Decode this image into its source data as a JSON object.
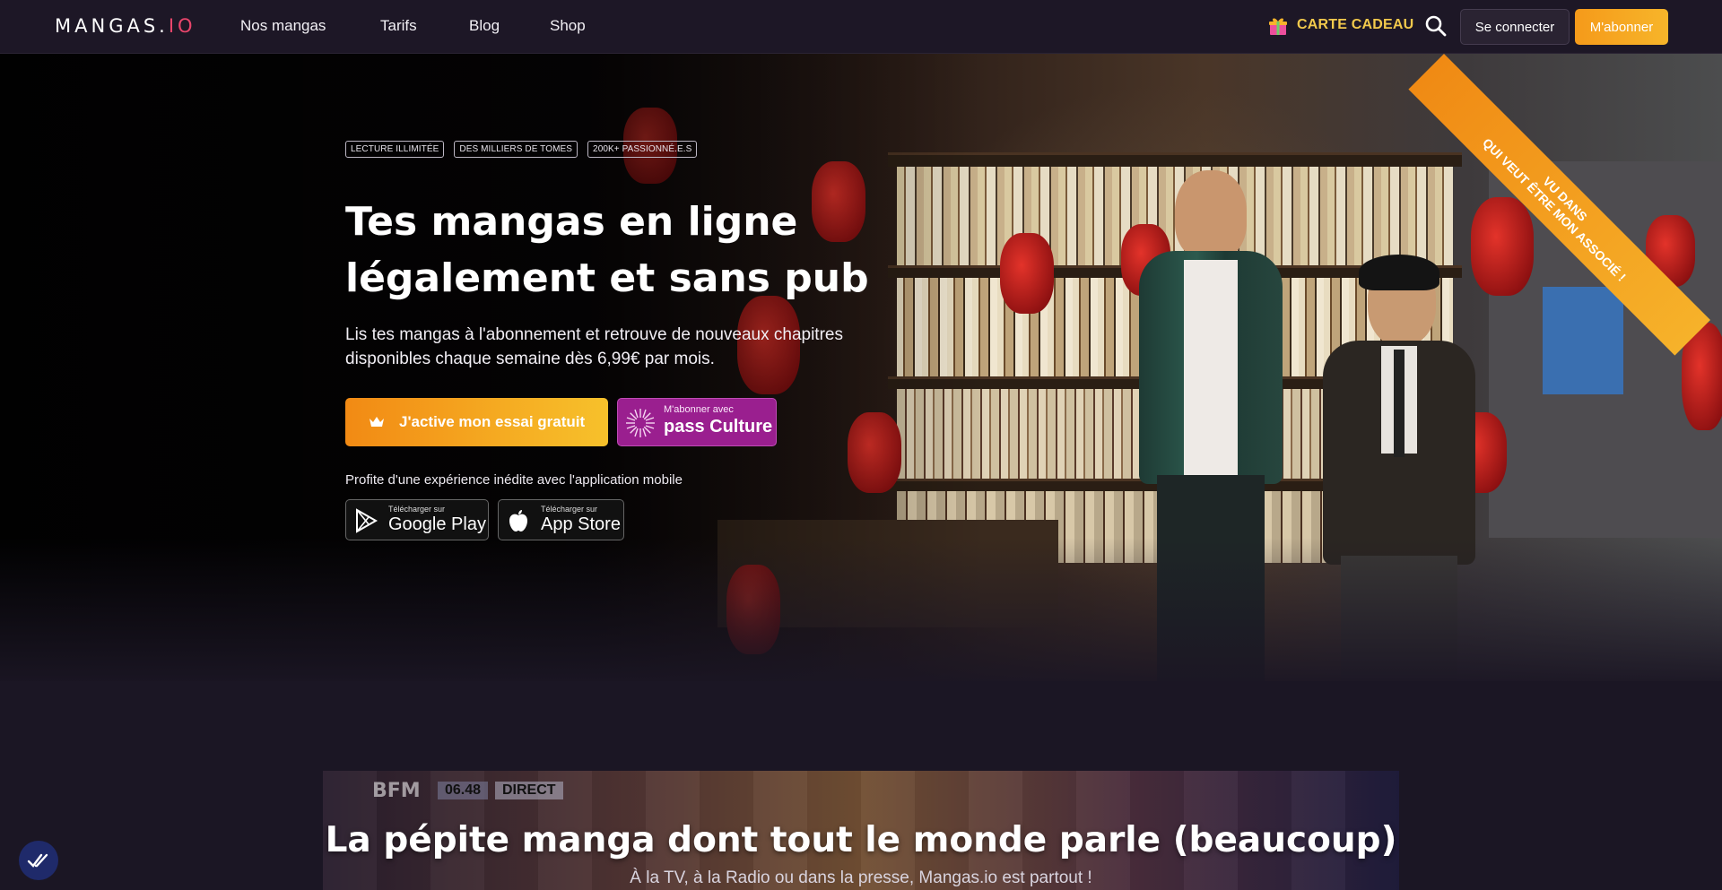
{
  "nav": {
    "logo_main": "MANGAS.",
    "logo_io": "IO",
    "links": [
      "Nos mangas",
      "Tarifs",
      "Blog",
      "Shop"
    ],
    "gift_label": "CARTE CADEAU",
    "login_label": "Se connecter",
    "subscribe_label": "M'abonner"
  },
  "hero": {
    "badges": [
      "LECTURE ILLIMITÉE",
      "DES MILLIERS DE TOMES",
      "200K+ PASSIONNÉ.E.S"
    ],
    "title_line1": "Tes mangas en ligne",
    "title_line2": "légalement et sans pub",
    "lead": "Lis tes mangas à l'abonnement et retrouve de nouveaux chapitres disponibles chaque semaine dès 6,99€ par mois.",
    "trial_label": "J'active mon essai gratuit",
    "pass_small": "M'abonner avec",
    "pass_big": "pass Culture",
    "app_text": "Profite d'une expérience inédite avec l'application mobile",
    "google_small": "Télécharger sur",
    "google_big": "Google Play",
    "apple_small": "Télécharger sur",
    "apple_big": "App Store",
    "ribbon_line1": "VU DANS",
    "ribbon_line2": "QUI VEUT ÊTRE MON ASSOCIÉ !"
  },
  "press": {
    "tv_channel": "BFM",
    "tv_time": "06.48",
    "tv_live": "DIRECT",
    "title": "La pépite manga dont tout le monde parle (beaucoup)",
    "subtitle": "À la TV, à la Radio ou dans la presse, Mangas.io est partout !"
  },
  "colors": {
    "accent_orange": "#f59a1a",
    "gift_yellow": "#f2c94c",
    "pass_purple": "#9a1f8f",
    "background": "#1b1624"
  }
}
